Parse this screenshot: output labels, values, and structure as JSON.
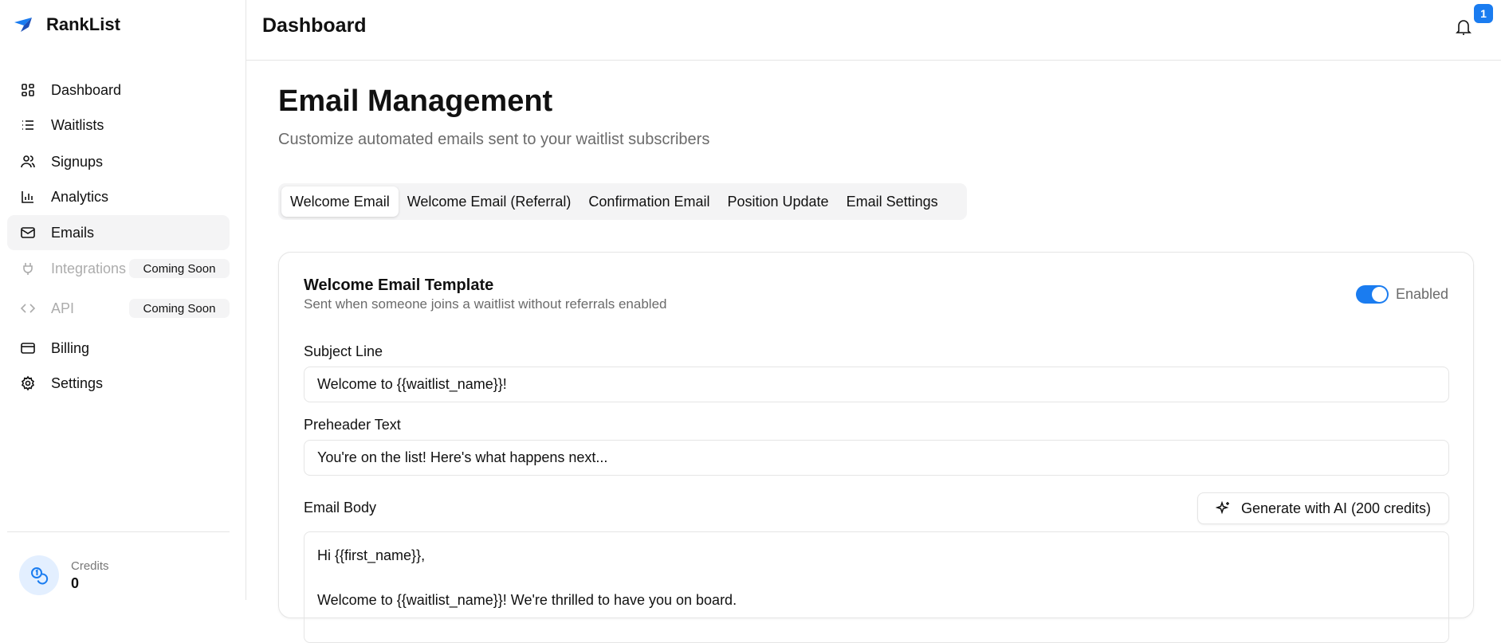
{
  "app": {
    "name": "RankList"
  },
  "sidebar": {
    "items": [
      {
        "label": "Dashboard",
        "icon": "grid-icon"
      },
      {
        "label": "Waitlists",
        "icon": "list-icon"
      },
      {
        "label": "Signups",
        "icon": "users-icon"
      },
      {
        "label": "Analytics",
        "icon": "bar-chart-icon"
      },
      {
        "label": "Emails",
        "icon": "mail-icon",
        "active": true
      },
      {
        "label": "Integrations",
        "icon": "plug-icon",
        "badge": "Coming Soon"
      },
      {
        "label": "API",
        "icon": "code-icon",
        "badge": "Coming Soon"
      },
      {
        "label": "Billing",
        "icon": "credit-card-icon"
      },
      {
        "label": "Settings",
        "icon": "gear-icon"
      }
    ],
    "credits": {
      "label": "Credits",
      "value": "0"
    }
  },
  "header": {
    "title": "Dashboard",
    "notifications": "1"
  },
  "page": {
    "title": "Email Management",
    "subtitle": "Customize automated emails sent to your waitlist subscribers"
  },
  "tabs": [
    "Welcome Email",
    "Welcome Email (Referral)",
    "Confirmation Email",
    "Position Update",
    "Email Settings"
  ],
  "card": {
    "title": "Welcome Email Template",
    "subtitle": "Sent when someone joins a waitlist without referrals enabled",
    "toggle_label": "Enabled",
    "toggle_on": true,
    "subject_label": "Subject Line",
    "subject_value": "Welcome to {{waitlist_name}}!",
    "preheader_label": "Preheader Text",
    "preheader_value": "You're on the list! Here's what happens next...",
    "body_label": "Email Body",
    "generate_label": "Generate with AI (200 credits)",
    "body_value": "Hi {{first_name}},\n\nWelcome to {{waitlist_name}}! We're thrilled to have you on board."
  },
  "colors": {
    "accent": "#1a7cf0"
  }
}
